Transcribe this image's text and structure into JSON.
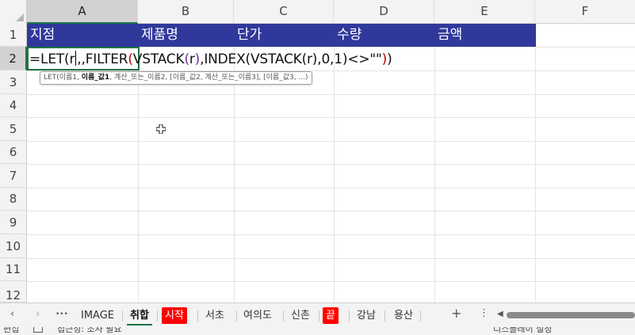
{
  "columns": [
    "A",
    "B",
    "C",
    "D",
    "E",
    "F"
  ],
  "rows": [
    "1",
    "2",
    "3",
    "4",
    "5",
    "6",
    "7",
    "8",
    "9",
    "10",
    "11",
    "12"
  ],
  "header_cells": [
    "지점",
    "제품명",
    "단가",
    "수량",
    "금액"
  ],
  "formula": {
    "p1": "=LET(r",
    "p2": ",",
    "p3": ",FILTER",
    "p4": "(",
    "p5": "VSTACK",
    "p6": "(",
    "p7": "r",
    "p8": ")",
    "p9": ",INDEX(VSTACK(r),0,1)<>\"\"",
    "p10": ")",
    "p11": ")"
  },
  "tooltip": {
    "prefix": "LET(이름1, ",
    "bold": "이름_값1",
    "suffix": ", 계산_또는_이름2, [이름_값2, 계산_또는_이름3], [이름_값3, ...)"
  },
  "tabs": {
    "more": "•••",
    "items": [
      "IMAGE",
      "취합",
      "시작",
      "서초",
      "여의도",
      "신촌",
      "끝",
      "강남",
      "용산"
    ],
    "active": "취합",
    "red_tabs": [
      "시작",
      "끝"
    ],
    "add": "+",
    "options": "⋮"
  },
  "status": {
    "mode": "편집",
    "accessibility": "접근성: 조사 필요",
    "display": "디스플레이 설정"
  },
  "colors": {
    "header_fill": "#30389b",
    "selection": "#217346",
    "red_tab": "#ff0000"
  }
}
